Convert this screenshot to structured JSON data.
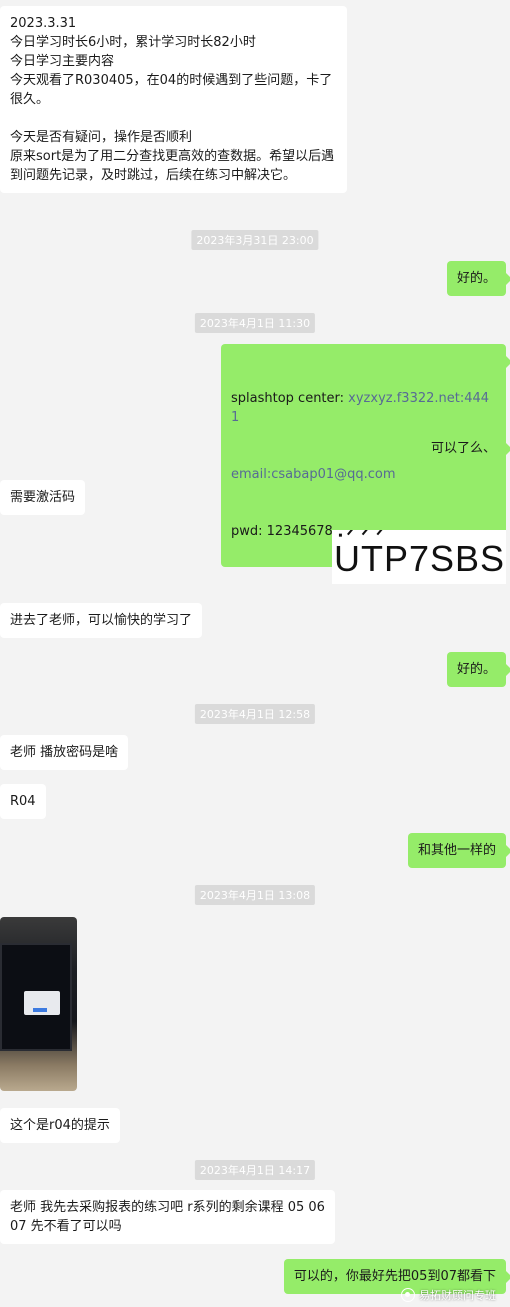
{
  "messages": {
    "m1": "2023.3.31\n今日学习时长6小时，累计学习时长82小时\n今日学习主要内容\n今天观看了R030405，在04的时候遇到了些问题，卡了很久。\n\n今天是否有疑问，操作是否顺利\n原来sort是为了用二分查找更高效的查数据。希望以后遇到问题先记录，及时跳过，后续在练习中解决它。",
    "m2": "好的。",
    "m3_line1_prefix": "splashtop center: ",
    "m3_line1_link": "xyzxyz.f3322.net:4441",
    "m3_line2": "email:csabap01@qq.com",
    "m3_line3": "pwd: 12345678",
    "m4": "可以了么、",
    "m5": "需要激活码",
    "m6_image_text": "UTP7SBS",
    "m7": "进去了老师，可以愉快的学习了",
    "m8": "好的。",
    "m9": "老师 播放密码是啥",
    "m10": "R04",
    "m11": "和其他一样的",
    "m13": "这个是r04的提示",
    "m14": "老师 我先去采购报表的练习吧 r系列的剩余课程 05 06 07 先不看了可以吗",
    "m15": "可以的，你最好先把05到07都看下"
  },
  "timestamps": {
    "t1": "2023年3月31日 23:00",
    "t2": "2023年4月1日 11:30",
    "t3": "2023年4月1日 12:58",
    "t4": "2023年4月1日 13:08",
    "t5": "2023年4月1日 14:17"
  },
  "watermark": {
    "text": "易拓财顾问专班",
    "icon": "wechat-channel-icon"
  },
  "colors": {
    "background": "#f3f3f3",
    "left_bubble": "#ffffff",
    "right_bubble": "#95ec69",
    "timestamp_bg": "#dadada",
    "link": "#576b95"
  }
}
